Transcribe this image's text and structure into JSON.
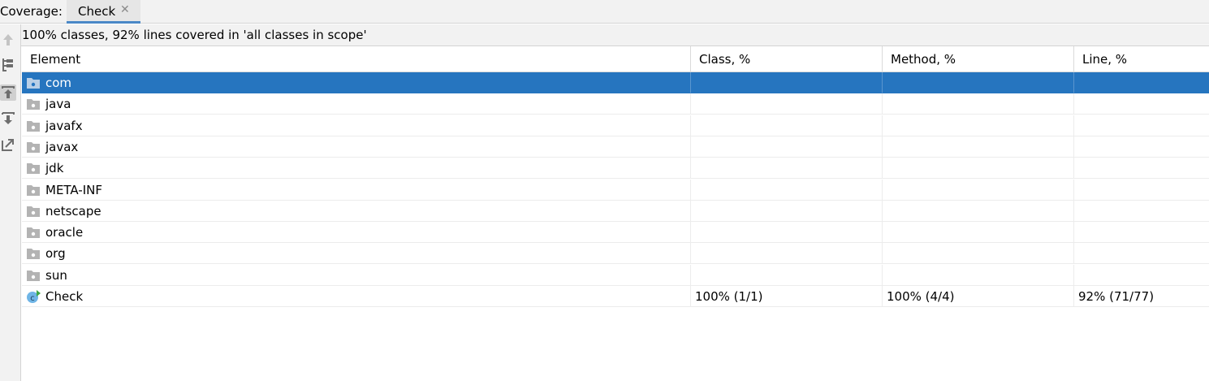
{
  "topbar": {
    "label": "Coverage:",
    "tab": {
      "title": "Check",
      "close": "✕"
    }
  },
  "toolbar": {
    "tools": [
      "up-arrow-icon",
      "flatten-packages-icon",
      "scroll-from-source-icon",
      "scroll-to-source-icon",
      "export-icon"
    ]
  },
  "summary": "100% classes, 92% lines covered in 'all classes in scope'",
  "table": {
    "columns": [
      "Element",
      "Class, %",
      "Method, %",
      "Line, %"
    ],
    "rows": [
      {
        "name": "com",
        "icon": "package-folder-icon",
        "class_pct": "",
        "method_pct": "",
        "line_pct": "",
        "selected": true
      },
      {
        "name": "java",
        "icon": "package-folder-icon",
        "class_pct": "",
        "method_pct": "",
        "line_pct": ""
      },
      {
        "name": "javafx",
        "icon": "package-folder-icon",
        "class_pct": "",
        "method_pct": "",
        "line_pct": ""
      },
      {
        "name": "javax",
        "icon": "package-folder-icon",
        "class_pct": "",
        "method_pct": "",
        "line_pct": ""
      },
      {
        "name": "jdk",
        "icon": "package-folder-icon",
        "class_pct": "",
        "method_pct": "",
        "line_pct": ""
      },
      {
        "name": "META-INF",
        "icon": "package-folder-icon",
        "class_pct": "",
        "method_pct": "",
        "line_pct": ""
      },
      {
        "name": "netscape",
        "icon": "package-folder-icon",
        "class_pct": "",
        "method_pct": "",
        "line_pct": ""
      },
      {
        "name": "oracle",
        "icon": "package-folder-icon",
        "class_pct": "",
        "method_pct": "",
        "line_pct": ""
      },
      {
        "name": "org",
        "icon": "package-folder-icon",
        "class_pct": "",
        "method_pct": "",
        "line_pct": ""
      },
      {
        "name": "sun",
        "icon": "package-folder-icon",
        "class_pct": "",
        "method_pct": "",
        "line_pct": ""
      },
      {
        "name": "Check",
        "icon": "class-icon",
        "class_pct": "100% (1/1)",
        "method_pct": "100% (4/4)",
        "line_pct": "92% (71/77)"
      }
    ]
  },
  "colors": {
    "selection": "#2675bf",
    "tab_underline": "#4a88c7"
  }
}
